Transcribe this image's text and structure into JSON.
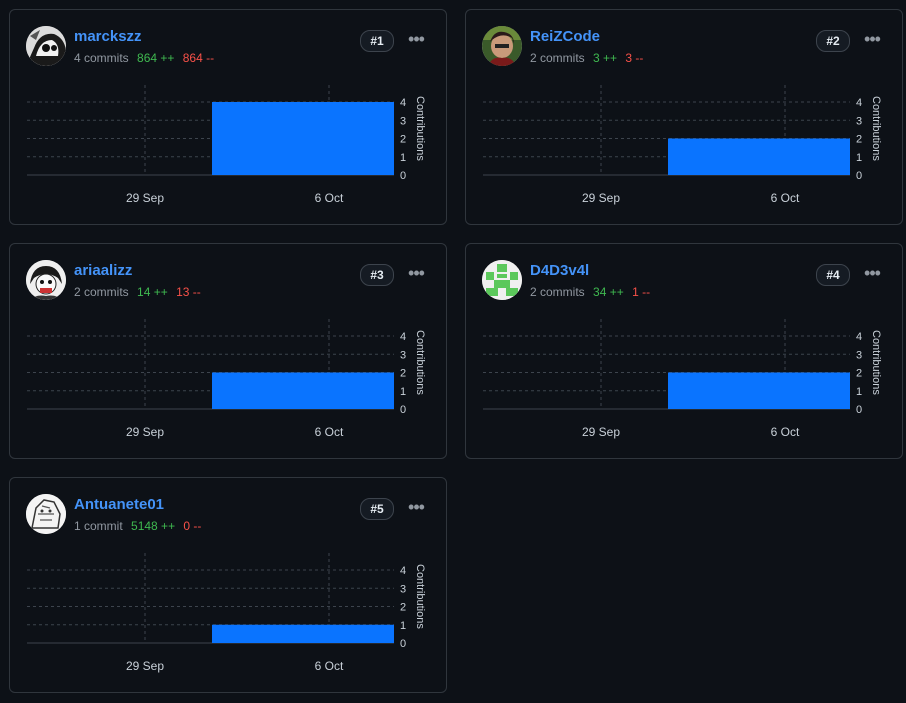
{
  "cards": [
    {
      "rank": "#1",
      "username": "marckszz",
      "commits": "4 commits",
      "additions": "864 ++",
      "deletions": "864 --",
      "avatar_icon": "manga-avatar-icon",
      "chart_data": {
        "type": "bar",
        "categories": [
          "29 Sep",
          "6 Oct"
        ],
        "values": [
          0,
          4
        ],
        "ylabel": "Contributions",
        "yticks": [
          0,
          1,
          2,
          3,
          4
        ],
        "ylim": [
          0,
          4
        ]
      }
    },
    {
      "rank": "#2",
      "username": "ReiZCode",
      "commits": "2 commits",
      "additions": "3 ++",
      "deletions": "3 --",
      "avatar_icon": "photo-avatar-icon",
      "chart_data": {
        "type": "bar",
        "categories": [
          "29 Sep",
          "6 Oct"
        ],
        "values": [
          0,
          2
        ],
        "ylabel": "Contributions",
        "yticks": [
          0,
          1,
          2,
          3,
          4
        ],
        "ylim": [
          0,
          4
        ]
      }
    },
    {
      "rank": "#3",
      "username": "ariaalizz",
      "commits": "2 commits",
      "additions": "14 ++",
      "deletions": "13 --",
      "avatar_icon": "manga-avatar-icon",
      "chart_data": {
        "type": "bar",
        "categories": [
          "29 Sep",
          "6 Oct"
        ],
        "values": [
          0,
          2
        ],
        "ylabel": "Contributions",
        "yticks": [
          0,
          1,
          2,
          3,
          4
        ],
        "ylim": [
          0,
          4
        ]
      }
    },
    {
      "rank": "#4",
      "username": "D4D3v4l",
      "commits": "2 commits",
      "additions": "34 ++",
      "deletions": "1 --",
      "avatar_icon": "identicon-avatar-icon",
      "chart_data": {
        "type": "bar",
        "categories": [
          "29 Sep",
          "6 Oct"
        ],
        "values": [
          0,
          2
        ],
        "ylabel": "Contributions",
        "yticks": [
          0,
          1,
          2,
          3,
          4
        ],
        "ylim": [
          0,
          4
        ]
      }
    },
    {
      "rank": "#5",
      "username": "Antuanete01",
      "commits": "1 commit",
      "additions": "5148 ++",
      "deletions": "0 --",
      "avatar_icon": "sketch-avatar-icon",
      "chart_data": {
        "type": "bar",
        "categories": [
          "29 Sep",
          "6 Oct"
        ],
        "values": [
          0,
          1
        ],
        "ylabel": "Contributions",
        "yticks": [
          0,
          1,
          2,
          3,
          4
        ],
        "ylim": [
          0,
          4
        ]
      }
    }
  ],
  "colors": {
    "bar": "#0a74ff",
    "link": "#4493f8",
    "additions": "#3fb950",
    "deletions": "#f85149",
    "border": "#30363d",
    "background": "#0d1117"
  }
}
